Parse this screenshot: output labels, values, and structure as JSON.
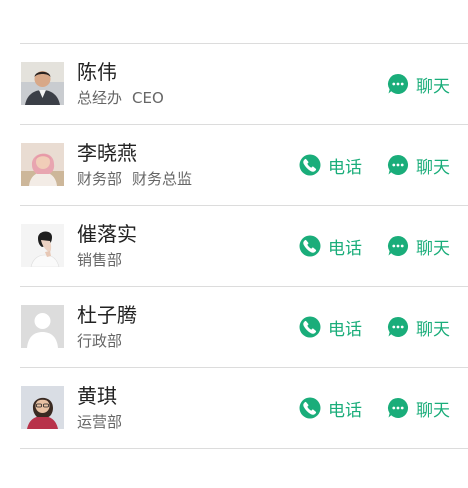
{
  "accent_color": "#1aad7a",
  "actions": {
    "call_label": "电话",
    "chat_label": "聊天",
    "call_icon": "phone-icon",
    "chat_icon": "chat-bubble-icon"
  },
  "contacts": [
    {
      "name": "陈伟",
      "department": "总经办",
      "title": "CEO",
      "has_call": false,
      "avatar": "photo-man-suit"
    },
    {
      "name": "李晓燕",
      "department": "财务部",
      "title": "财务总监",
      "has_call": true,
      "avatar": "photo-woman-pink-hair"
    },
    {
      "name": "催落实",
      "department": "销售部",
      "title": "",
      "has_call": true,
      "avatar": "photo-woman-profile"
    },
    {
      "name": "杜子腾",
      "department": "行政部",
      "title": "",
      "has_call": true,
      "avatar": "default-avatar-placeholder"
    },
    {
      "name": "黄琪",
      "department": "运营部",
      "title": "",
      "has_call": true,
      "avatar": "photo-woman-glasses"
    }
  ]
}
